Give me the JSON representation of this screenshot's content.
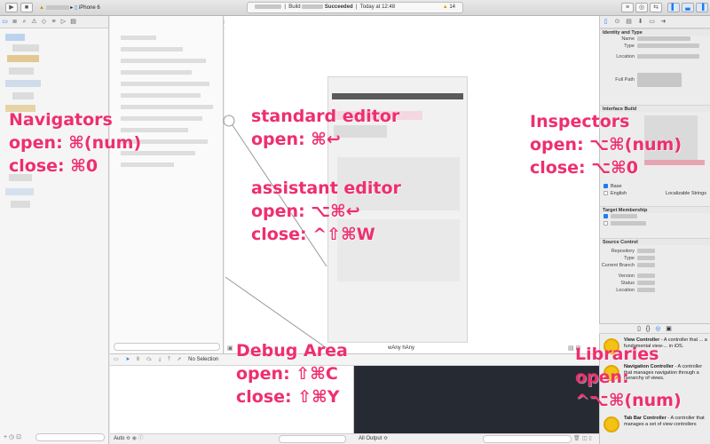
{
  "toolbar": {
    "run_icon": "▶",
    "stop_icon": "■",
    "device": "iPhone 6",
    "activity": {
      "prefix": "Build",
      "status": "Succeeded",
      "time": "Today at 12:48",
      "warning_count": "14"
    }
  },
  "debug": {
    "no_selection": "No Selection",
    "auto_label": "Auto ≎",
    "output_label": "All Output ≎"
  },
  "canvas": {
    "size_class": "wAny hAny"
  },
  "inspector": {
    "identity_header": "Identity and Type",
    "name_label": "Name",
    "type_label": "Type",
    "location_label": "Location",
    "full_path_label": "Full Path",
    "ib_header": "Interface Build",
    "localization_base": "Base",
    "localization_english": "English",
    "localizable_strings": "Localizable Strings",
    "target_header": "Target Membership",
    "source_header": "Source Control",
    "sc_rows": [
      "Repository",
      "Type",
      "Current Branch",
      "Version",
      "Status",
      "Location"
    ]
  },
  "library": [
    {
      "title": "View Controller",
      "desc": " - A controller that ... a fundamental view-... in iOS."
    },
    {
      "title": "Navigation Controller",
      "desc": " - A controller that manages navigation through a hierarchy of views."
    },
    {
      "title": "Tab Bar Controller",
      "desc": " - A controller that manages a set of view controllers"
    }
  ],
  "annotations": {
    "navigators": [
      "Navigators",
      "open: ⌘(num)",
      "close: ⌘0"
    ],
    "standard_editor": [
      "standard editor",
      "open: ⌘↩"
    ],
    "assistant_editor": [
      "assistant editor",
      "open: ⌥⌘↩",
      "close: ^⇧⌘W"
    ],
    "inspectors": [
      "Inspectors",
      "open: ⌥⌘(num)",
      "close: ⌥⌘0"
    ],
    "debug_area": [
      "Debug Area",
      "open: ⇧⌘C",
      "close: ⇧⌘Y"
    ],
    "libraries": [
      "Libraries",
      "open:",
      "^⌥⌘(num)"
    ]
  },
  "colors": {
    "annotation": "#ee2f6e",
    "accent": "#1e7bf5",
    "console": "#262a33"
  }
}
